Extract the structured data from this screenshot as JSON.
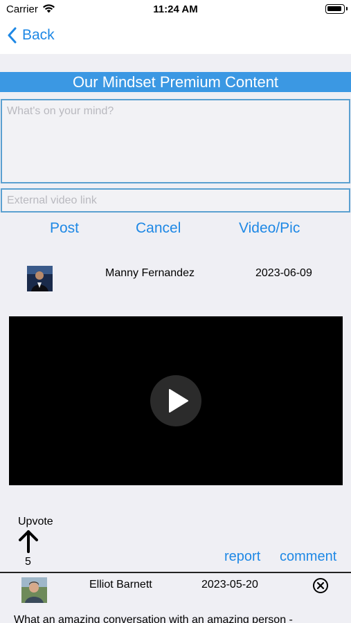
{
  "status": {
    "carrier": "Carrier",
    "time": "11:24 AM"
  },
  "nav": {
    "back_label": "Back"
  },
  "header": {
    "title": "Our Mindset Premium Content"
  },
  "compose": {
    "text_placeholder": "What's on your mind?",
    "link_placeholder": "External video link",
    "post_label": "Post",
    "cancel_label": "Cancel",
    "media_label": "Video/Pic"
  },
  "post": {
    "author": "Manny Fernandez",
    "date": "2023-06-09",
    "upvote_label": "Upvote",
    "votes": "5",
    "report_label": "report",
    "comment_label": "comment"
  },
  "reply": {
    "author": "Elliot Barnett",
    "date": "2023-05-20",
    "text": "What an amazing conversation with an amazing person -"
  },
  "colors": {
    "accent": "#1e88e5",
    "title_bar": "#3b98e3",
    "background": "#efeff4"
  }
}
